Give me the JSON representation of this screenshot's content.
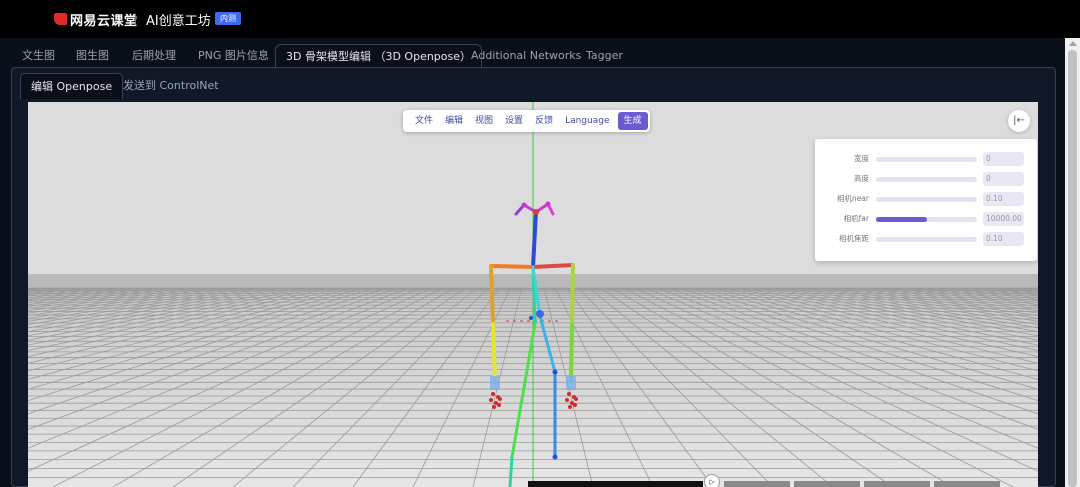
{
  "header": {
    "brand": "网易云课堂",
    "product": "AI创意工坊",
    "badge": "内测"
  },
  "tabs": [
    {
      "label": "文生图"
    },
    {
      "label": "图生图"
    },
    {
      "label": "后期处理"
    },
    {
      "label": "PNG 图片信息"
    },
    {
      "label": "3D 骨架模型编辑 （3D Openpose）",
      "active": true
    },
    {
      "label": "Additional Networks"
    },
    {
      "label": "Tagger"
    }
  ],
  "subtabs": [
    {
      "label": "编辑 Openpose",
      "active": true
    },
    {
      "label": "发送到 ControlNet"
    }
  ],
  "editor_menu": {
    "items": [
      "文件",
      "编辑",
      "视图",
      "设置",
      "反馈",
      "Language"
    ],
    "primary": "生成"
  },
  "collapse_icon": "collapse-left-icon",
  "settings": {
    "rows": [
      {
        "label": "宽度",
        "value": "0",
        "fraction": 0
      },
      {
        "label": "高度",
        "value": "0",
        "fraction": 0
      },
      {
        "label": "相机near",
        "value": "0.10",
        "fraction": 0
      },
      {
        "label": "相机far",
        "value": "10000.00",
        "fraction": 0.5
      },
      {
        "label": "相机焦距",
        "value": "0.10",
        "fraction": 0
      }
    ]
  },
  "colors": {
    "accent": "#6a5bd3",
    "badge": "#3d6af2",
    "logo": "#e12b2b",
    "background": "#0b0f19"
  }
}
